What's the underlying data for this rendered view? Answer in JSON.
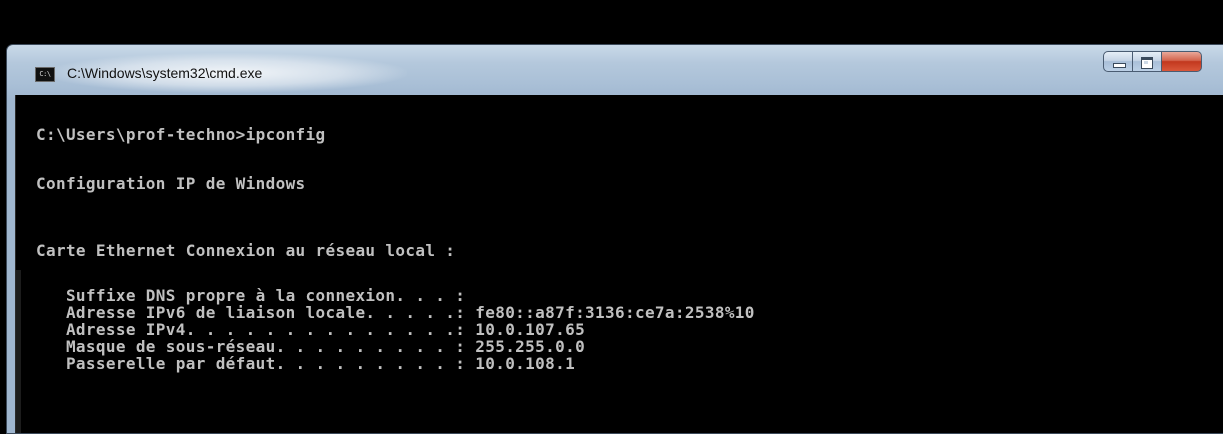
{
  "window": {
    "title": "C:\\Windows\\system32\\cmd.exe",
    "icon_label": "C:\\",
    "icon": "cmd-console-icon",
    "controls": [
      "minimize-icon",
      "maximize-icon",
      "close-icon"
    ]
  },
  "colors": {
    "console_background": "#000000",
    "console_text": "#c0c0c0",
    "titlebar": "#b4c8dc",
    "close_button": "#c2381e"
  },
  "console": {
    "prompt_line": "C:\\Users\\prof-techno>ipconfig",
    "header": "Configuration IP de Windows",
    "adapter_title": "Carte Ethernet Connexion au réseau local :",
    "entries": [
      "   Suffixe DNS propre à la connexion. . . :",
      "   Adresse IPv6 de liaison locale. . . . .: fe80::a87f:3136:ce7a:2538%10",
      "   Adresse IPv4. . . . . . . . . . . . . .: 10.0.107.65",
      "   Masque de sous-réseau. . . . . . . . . : 255.255.0.0",
      "   Passerelle par défaut. . . . . . . . . : 10.0.108.1"
    ]
  }
}
